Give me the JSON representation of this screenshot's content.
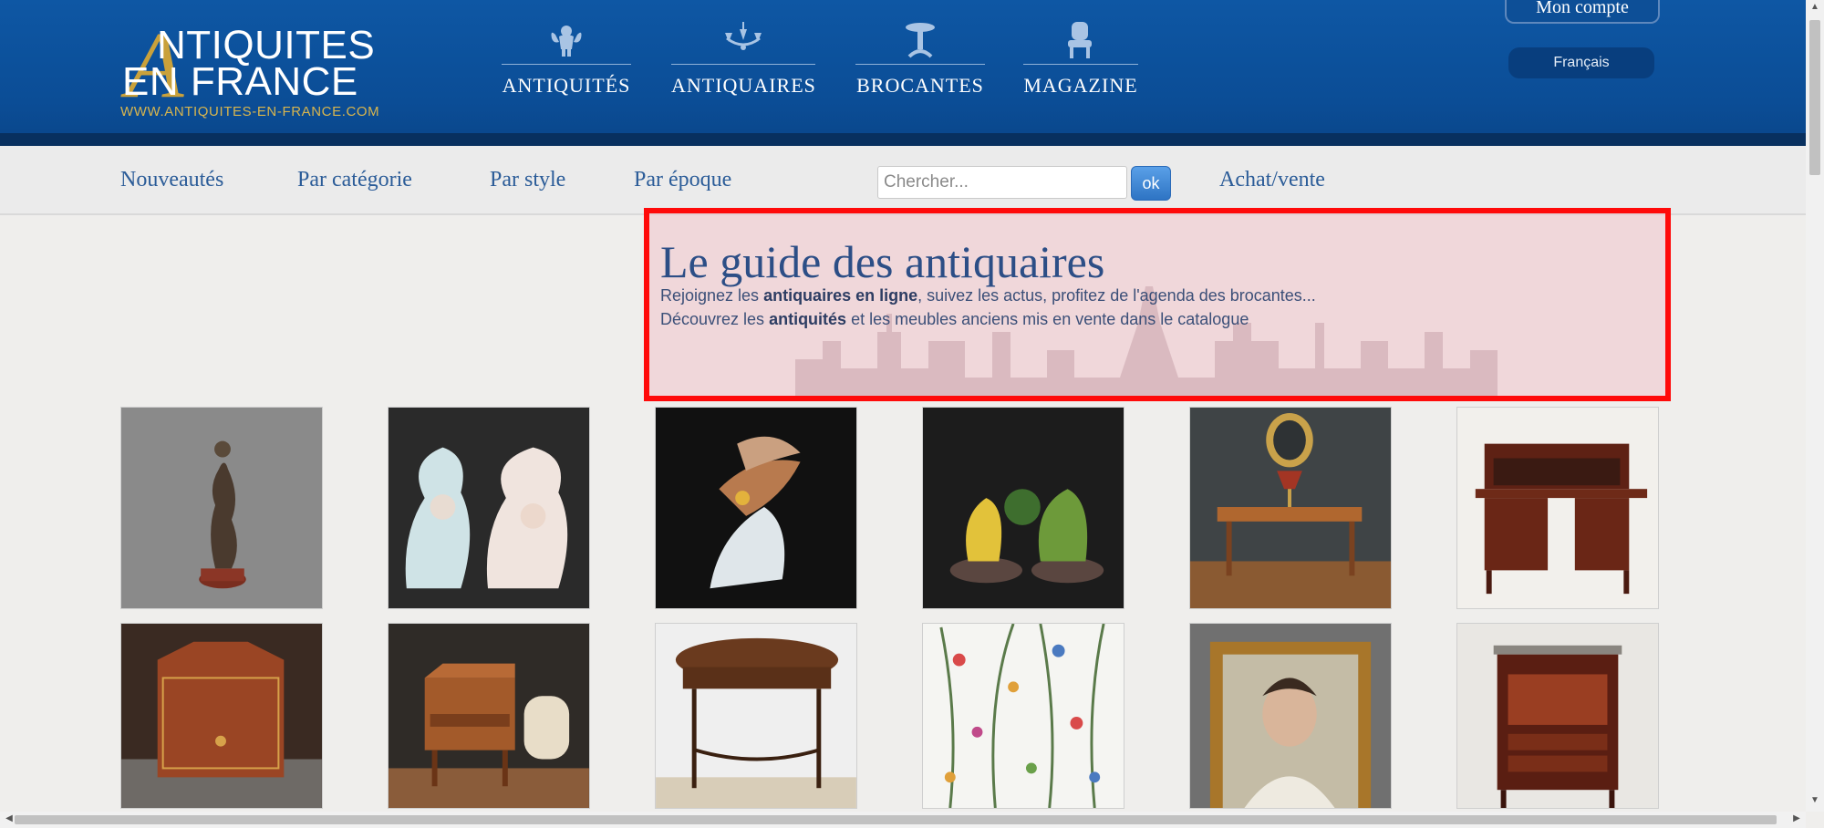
{
  "logo": {
    "big_letter": "A",
    "line1": "NTIQUITES",
    "line2": "EN FRANCE",
    "url": "WWW.ANTIQUITES-EN-FRANCE.COM"
  },
  "main_nav": [
    {
      "label": "ANTIQUITÉS",
      "icon": "cherub-icon"
    },
    {
      "label": "ANTIQUAIRES",
      "icon": "chandelier-icon"
    },
    {
      "label": "BROCANTES",
      "icon": "pedestal-table-icon"
    },
    {
      "label": "MAGAZINE",
      "icon": "armchair-icon"
    }
  ],
  "account": {
    "label": "Mon compte"
  },
  "language": {
    "label": "Français"
  },
  "subnav": {
    "items": [
      "Nouveautés",
      "Par catégorie",
      "Par style",
      "Par époque"
    ],
    "search_placeholder": "Chercher...",
    "ok_label": "ok",
    "achat_vente": "Achat/vente"
  },
  "hero": {
    "title": "Le guide des antiquaires",
    "line1_a": "Rejoignez les ",
    "line1_b": "antiquaires en ligne",
    "line1_c": ", suivez les actus, profitez de l'agenda des brocantes...",
    "line2_a": "Découvrez les ",
    "line2_b": "antiquités",
    "line2_c": " et les meubles anciens mis en vente dans le catalogue"
  },
  "products": [
    {
      "subject": "bronze-statue",
      "bg": "#8a8a8a"
    },
    {
      "subject": "porcelain-vases",
      "bg": "#2a2a2a"
    },
    {
      "subject": "porcelain-bird",
      "bg": "#111111"
    },
    {
      "subject": "bird-figurines",
      "bg": "#1c1c1c"
    },
    {
      "subject": "writing-desk-lamp",
      "bg": "#3f4446"
    },
    {
      "subject": "roll-top-desk",
      "bg": "#f2f0ec"
    },
    {
      "subject": "leather-box",
      "bg": "#3a2a22"
    },
    {
      "subject": "slant-front-desk",
      "bg": "#2f2b27"
    },
    {
      "subject": "side-table",
      "bg": "#efefef"
    },
    {
      "subject": "floral-wallpaper",
      "bg": "#f5f5f2"
    },
    {
      "subject": "framed-portrait",
      "bg": "#707070"
    },
    {
      "subject": "secretaire",
      "bg": "#e9e7e3"
    }
  ],
  "colors": {
    "header_blue": "#0b4d96",
    "gold": "#c9a13b",
    "link_blue": "#2b5c98",
    "highlight_red": "#ff0a0a"
  }
}
